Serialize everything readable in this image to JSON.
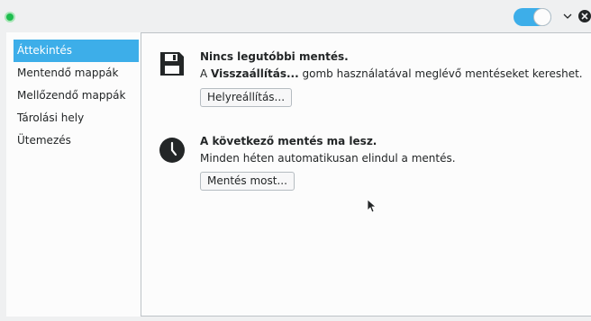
{
  "window": {
    "status_color": "#1fbd4f",
    "accent": "#3daee9",
    "toggle_on": true,
    "minimize_icon": "chevron-down-icon",
    "close_icon": "close-icon"
  },
  "sidebar": {
    "items": [
      {
        "label": "Áttekintés",
        "active": true
      },
      {
        "label": "Mentendő mappák",
        "active": false
      },
      {
        "label": "Mellőzendő mappák",
        "active": false
      },
      {
        "label": "Tárolási hely",
        "active": false
      },
      {
        "label": "Ütemezés",
        "active": false
      }
    ]
  },
  "overview": {
    "backup": {
      "icon": "floppy-disk-icon",
      "title": "Nincs legutóbbi mentés.",
      "desc_prefix": "A ",
      "desc_bold": "Visszaállítás...",
      "desc_suffix": " gomb használatával meglévő mentéseket kereshet.",
      "button_label": "Helyreállítás..."
    },
    "schedule": {
      "icon": "clock-icon",
      "title": "A következő mentés ma lesz.",
      "desc": "Minden héten automatikusan elindul a mentés.",
      "button_label": "Mentés most..."
    }
  }
}
